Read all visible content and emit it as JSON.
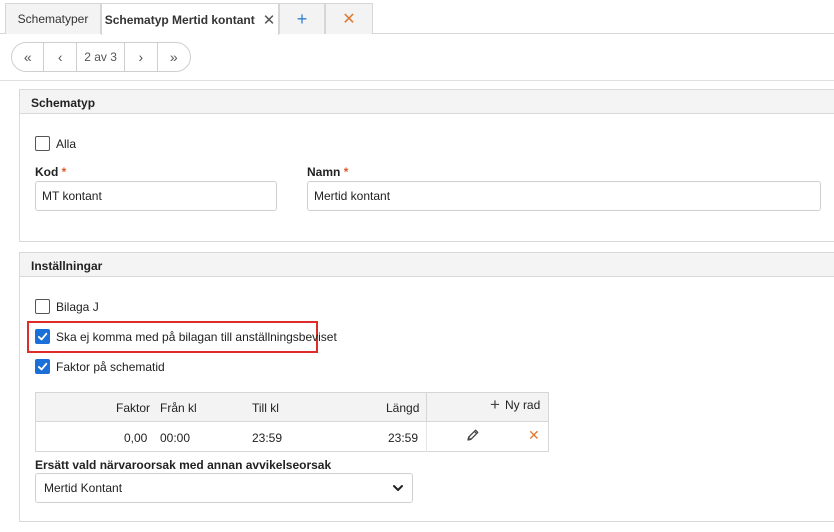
{
  "tabs": [
    {
      "label": "Schematyper"
    },
    {
      "label": "Schematyp Mertid kontant",
      "close": "✕"
    }
  ],
  "tab_actions": {
    "add": "+",
    "close_all": "✕"
  },
  "pager": {
    "first": "«",
    "prev": "‹",
    "info": "2 av 3",
    "next": "›",
    "last": "»"
  },
  "schematyp": {
    "header": "Schematyp",
    "alla_label": "Alla",
    "kod_label": "Kod",
    "kod_value": "MT kontant",
    "namn_label": "Namn",
    "namn_value": "Mertid kontant",
    "required_mark": "*"
  },
  "installningar": {
    "header": "Inställningar",
    "bilaga_label": "Bilaga J",
    "ska_ej_label": "Ska ej komma med på bilagan till anställningsbeviset",
    "faktor_label": "Faktor på schematid",
    "table": {
      "headers": {
        "faktor": "Faktor",
        "fran": "Från kl",
        "till": "Till kl",
        "langd": "Längd",
        "ny_rad": "Ny rad"
      },
      "rows": [
        {
          "faktor": "0,00",
          "fran": "00:00",
          "till": "23:59",
          "langd": "23:59"
        }
      ]
    },
    "ersatt_label": "Ersätt vald närvaroorsak med annan avvikelseorsak",
    "ersatt_value": "Mertid Kontant"
  },
  "colors": {
    "accent": "#1a6fd8",
    "required": "#e05a2a",
    "delete": "#e07a2f",
    "highlight": "#e02b2b"
  }
}
